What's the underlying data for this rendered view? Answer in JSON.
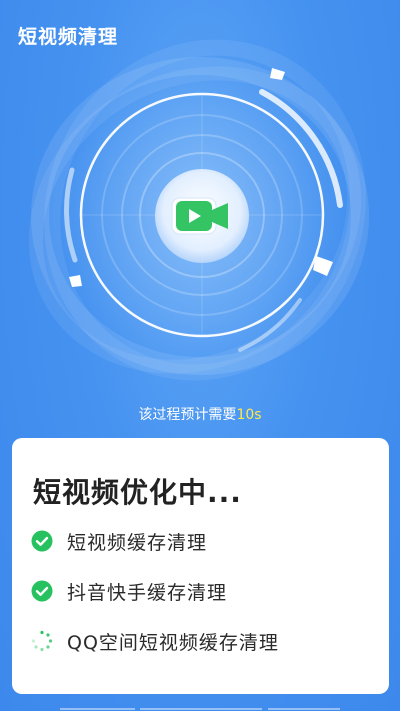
{
  "header": {
    "title": "短视频清理"
  },
  "scan": {
    "hint_prefix": "该过程预计需要",
    "hint_seconds": "10s",
    "center_icon": "video-camera-icon"
  },
  "card": {
    "title": "短视频优化中...",
    "tasks": [
      {
        "label": "短视频缓存清理",
        "status": "done",
        "icon": "check-circle-icon"
      },
      {
        "label": "抖音快手缓存清理",
        "status": "done",
        "icon": "check-circle-icon"
      },
      {
        "label": "QQ空间短视频缓存清理",
        "status": "in-progress",
        "icon": "loading-spinner-icon"
      }
    ]
  },
  "colors": {
    "background": "#3f8ef0",
    "accent_yellow": "#ffe94a",
    "success_green": "#27c25f",
    "video_green": "#2bbf5a"
  }
}
